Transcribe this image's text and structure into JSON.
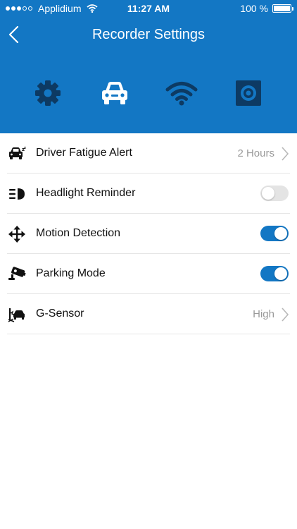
{
  "status_bar": {
    "carrier": "Applidium",
    "time": "11:27 AM",
    "battery": "100 %",
    "battery_level": 1.0,
    "signal_bars_filled": 3,
    "signal_bars_total": 5
  },
  "nav": {
    "title": "Recorder Settings",
    "back_icon": "chevron-left-icon"
  },
  "tabs": [
    {
      "name": "settings",
      "icon": "gear-icon"
    },
    {
      "name": "car",
      "icon": "car-icon",
      "active": true
    },
    {
      "name": "wifi",
      "icon": "wifi-icon"
    },
    {
      "name": "camera",
      "icon": "camera-lens-icon"
    }
  ],
  "settings": [
    {
      "label": "Driver Fatigue Alert",
      "value": "2 Hours",
      "control": "disclosure",
      "icon": "drowsy-car-icon"
    },
    {
      "label": "Headlight Reminder",
      "control": "toggle",
      "on": false,
      "icon": "headlight-icon"
    },
    {
      "label": "Motion Detection",
      "control": "toggle",
      "on": true,
      "icon": "move-arrows-icon"
    },
    {
      "label": "Parking Mode",
      "control": "toggle",
      "on": true,
      "icon": "security-camera-icon"
    },
    {
      "label": "G-Sensor",
      "value": "High",
      "control": "disclosure",
      "icon": "collision-icon"
    }
  ],
  "colors": {
    "header": "#1377c4",
    "tab_inactive": "#0d3a63",
    "toggle_on": "#1377c4",
    "toggle_off": "#e4e4e4"
  }
}
